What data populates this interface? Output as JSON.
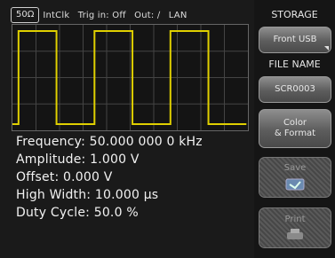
{
  "status_bar": {
    "impedance": "50Ω",
    "clock": "IntClk",
    "trigger": "Trig in: Off",
    "output": "Out: ∕",
    "interface": "LAN"
  },
  "waveform": {
    "type": "square",
    "color": "#e0d000",
    "duty_cycle": 0.5,
    "cycles_visible": 3
  },
  "parameters": {
    "frequency": "Frequency: 50.000 000 0 kHz",
    "amplitude": "Amplitude: 1.000 V",
    "offset": "Offset: 0.000 V",
    "high_width": "High Width: 10.000 µs",
    "duty_cycle": "Duty Cycle: 50.0 %"
  },
  "side_panel": {
    "storage_title": "STORAGE",
    "storage_value": "Front USB",
    "file_name_title": "FILE NAME",
    "file_name_value": "SCR0003",
    "color_format_line1": "Color",
    "color_format_line2": "& Format",
    "save_label": "Save",
    "print_label": "Print"
  }
}
